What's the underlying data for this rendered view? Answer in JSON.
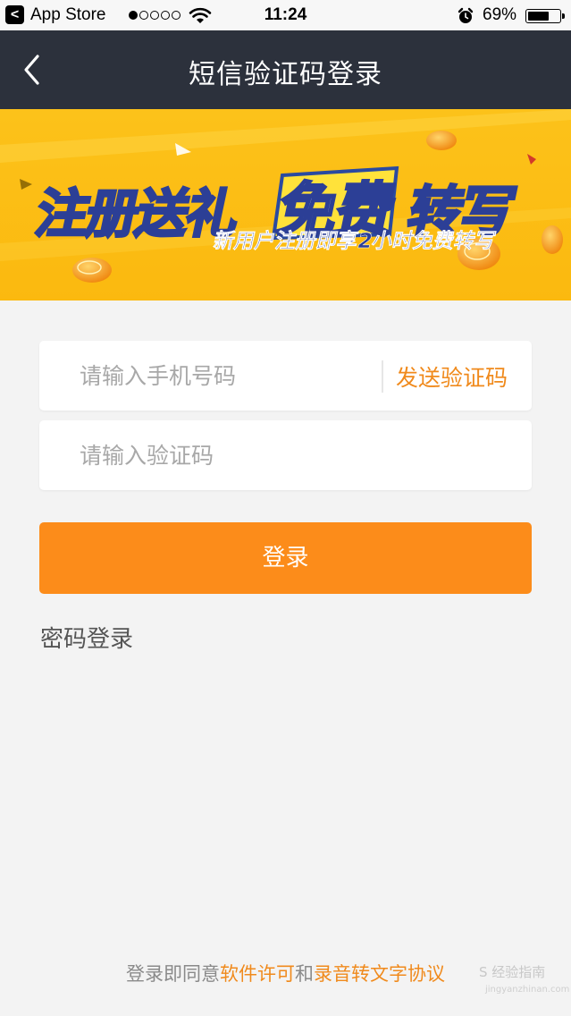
{
  "status_bar": {
    "back_glyph": "<",
    "carrier": "App Store",
    "signal_bars": 1,
    "signal_total": 5,
    "time": "11:24",
    "battery_percent": "69%",
    "battery_level": 0.69
  },
  "nav": {
    "back_icon": "chevron-left-icon",
    "title": "短信验证码登录"
  },
  "banner": {
    "headline_left": "注册送礼",
    "headline_highlight": "免费",
    "headline_right": "转写",
    "subline": "新用户注册即享2小时免费转写"
  },
  "form": {
    "phone_placeholder": "请输入手机号码",
    "send_code_label": "发送验证码",
    "code_placeholder": "请输入验证码",
    "login_label": "登录",
    "password_login_label": "密码登录"
  },
  "footer": {
    "agreement_prefix": "登录即同意",
    "license_link": "软件许可",
    "conjunction": "和",
    "protocol_link": "录音转文字协议",
    "watermark": "S 经验指南",
    "watermark_url": "jingyanzhinan.com"
  },
  "colors": {
    "nav_bg": "#2c313c",
    "banner_yellow": "#fcc21a",
    "accent_orange": "#fc8c1a",
    "link_orange": "#f08a1c",
    "page_bg": "#f3f3f3"
  }
}
